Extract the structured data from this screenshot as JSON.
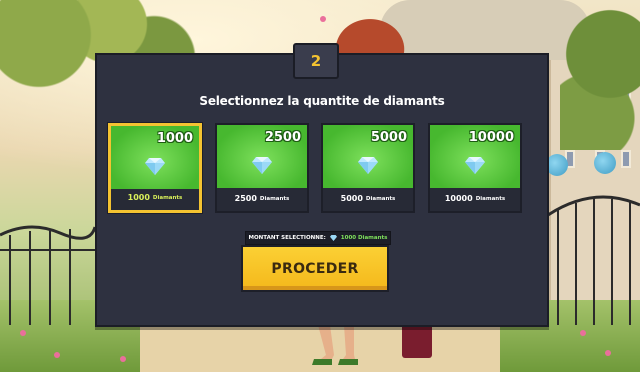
{
  "step": {
    "number": "2"
  },
  "panel": {
    "title": "Selectionnez la quantite de diamants"
  },
  "packages": [
    {
      "amount": "1000",
      "label_number": "1000",
      "label_unit": "Diamants",
      "selected": true,
      "icon": "diamond-icon"
    },
    {
      "amount": "2500",
      "label_number": "2500",
      "label_unit": "Diamants",
      "selected": false,
      "icon": "diamond-icon"
    },
    {
      "amount": "5000",
      "label_number": "5000",
      "label_unit": "Diamants",
      "selected": false,
      "icon": "diamond-icon"
    },
    {
      "amount": "10000",
      "label_number": "10000",
      "label_unit": "Diamants",
      "selected": false,
      "icon": "diamond-icon"
    }
  ],
  "selection": {
    "label": "MONTANT SELECTIONNE:",
    "value": "1000 Diamants",
    "icon": "diamond-icon"
  },
  "proceed": {
    "label": "PROCEDER"
  },
  "colors": {
    "panel": "#2e3140",
    "accent": "#f4c331",
    "card_green": "#47b82f",
    "selected_text": "#d9f05a"
  }
}
